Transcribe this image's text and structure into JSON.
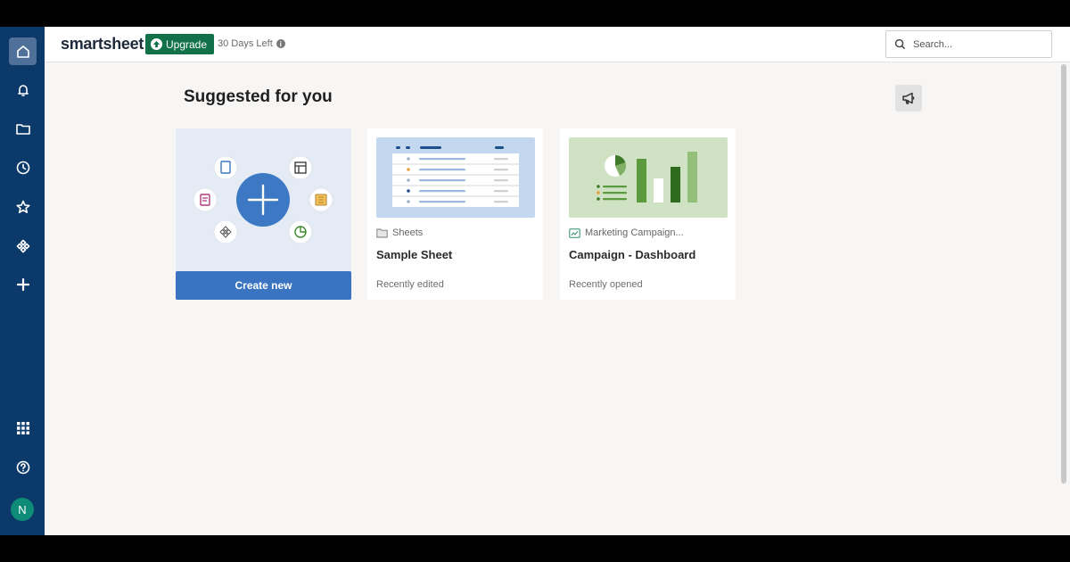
{
  "topbar": {
    "logo": "smartsheet",
    "upgrade_label": "Upgrade",
    "trial_text": "30 Days Left",
    "search_placeholder": "Search..."
  },
  "sidebar": {
    "items": [
      {
        "icon": "home-icon",
        "active": true
      },
      {
        "icon": "bell-icon"
      },
      {
        "icon": "folder-icon"
      },
      {
        "icon": "clock-icon"
      },
      {
        "icon": "star-icon"
      },
      {
        "icon": "solutions-icon"
      },
      {
        "icon": "plus-icon"
      },
      {
        "icon": "apps-grid-icon"
      },
      {
        "icon": "help-icon"
      }
    ],
    "avatar_initial": "N"
  },
  "main": {
    "section_title": "Suggested for you",
    "create_card": {
      "button_label": "Create new"
    },
    "cards": [
      {
        "location": "Sheets",
        "title": "Sample Sheet",
        "meta": "Recently edited"
      },
      {
        "location": "Marketing Campaign...",
        "title": "Campaign - Dashboard",
        "meta": "Recently opened"
      }
    ]
  },
  "colors": {
    "sidebar_bg": "#0b3a6a",
    "upgrade_green": "#13714a",
    "create_blue": "#3a74c0",
    "avatar_teal": "#0f8c77"
  }
}
